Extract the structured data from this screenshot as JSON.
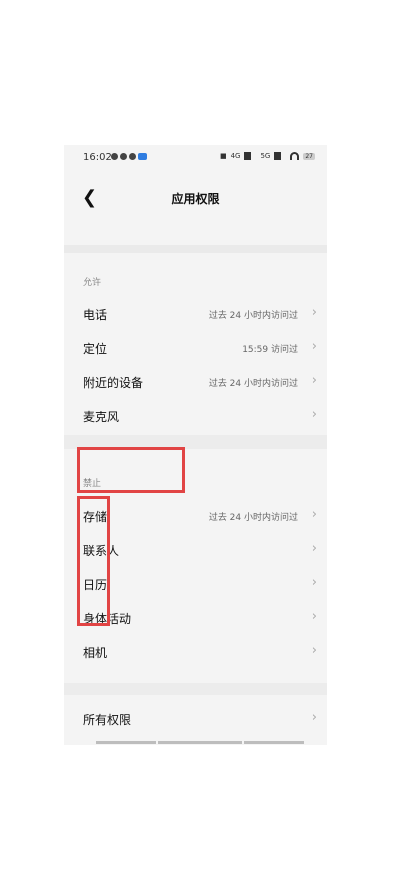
{
  "status": {
    "time": "16:02",
    "battery": "27",
    "net1": "4G",
    "net2": "5G"
  },
  "header": {
    "back_glyph": "❮",
    "title": "应用权限"
  },
  "sections": {
    "allowed_label": "允许",
    "denied_label": "禁止"
  },
  "allowed": [
    {
      "label": "电话",
      "value": "过去 24 小时内访问过"
    },
    {
      "label": "定位",
      "value": "15:59 访问过"
    },
    {
      "label": "附近的设备",
      "value": "过去 24 小时内访问过"
    },
    {
      "label": "麦克风",
      "value": ""
    }
  ],
  "denied": [
    {
      "label": "存储",
      "value": "过去 24 小时内访问过"
    },
    {
      "label": "联系人",
      "value": ""
    },
    {
      "label": "日历",
      "value": ""
    },
    {
      "label": "身体活动",
      "value": ""
    },
    {
      "label": "相机",
      "value": ""
    }
  ],
  "all_permissions": {
    "label": "所有权限"
  },
  "colors": {
    "highlight": "#e14444"
  }
}
